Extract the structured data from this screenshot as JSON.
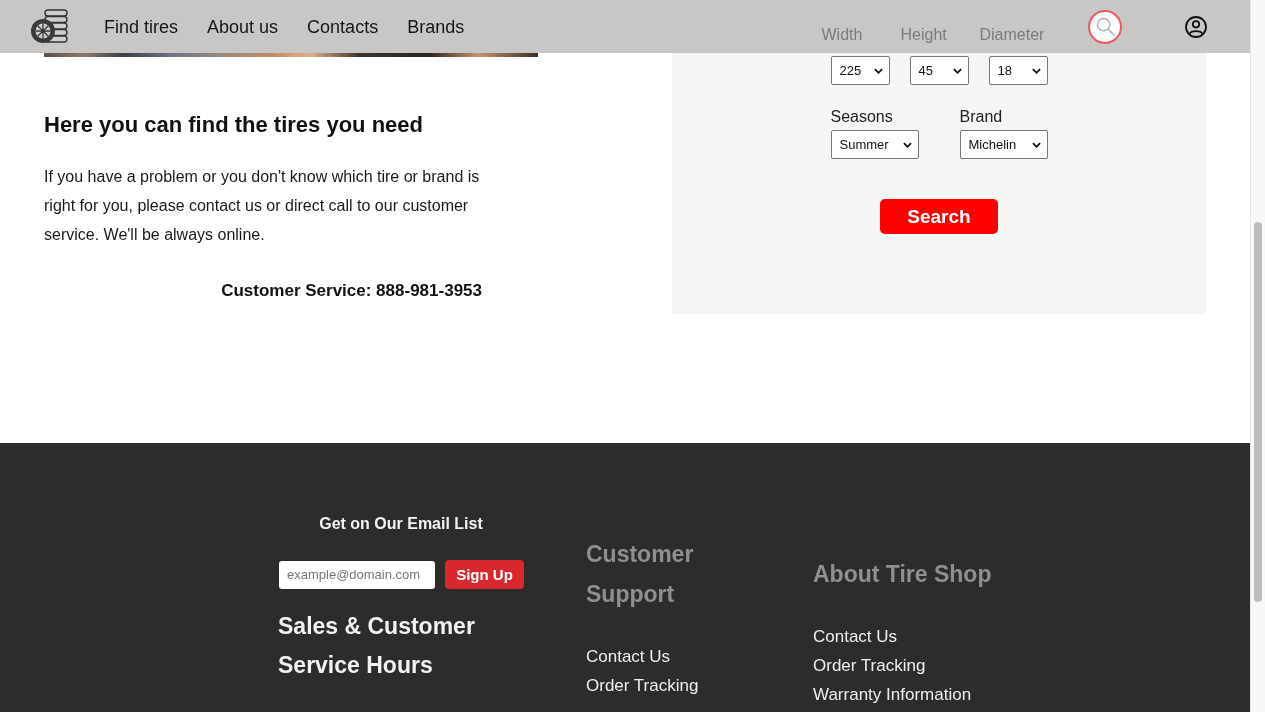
{
  "header": {
    "nav": [
      "Find tires",
      "About us",
      "Contacts",
      "Brands"
    ]
  },
  "intro": {
    "title": "Here you can find the tires you need",
    "text": "If you have a problem or you don't know which tire or brand is right for you, please contact us or direct call to our customer service. We'll be always online.",
    "customer_service": "Customer Service: 888-981-3953"
  },
  "filter": {
    "size_fields": [
      {
        "label": "Width",
        "value": "225"
      },
      {
        "label": "Height",
        "value": "45"
      },
      {
        "label": "Diameter",
        "value": "18"
      }
    ],
    "option_fields": [
      {
        "label": "Seasons",
        "value": "Summer"
      },
      {
        "label": "Brand",
        "value": "Michelin"
      }
    ],
    "search_button": "Search"
  },
  "footer": {
    "newsletter": {
      "title": "Get on Our Email List",
      "placeholder": "example@domain.com",
      "button": "Sign Up"
    },
    "hours_title": "Sales & Customer Service Hours",
    "columns": [
      {
        "title": "Customer Support",
        "links": [
          "Contact Us",
          "Order Tracking"
        ]
      },
      {
        "title": "About Tire Shop",
        "links": [
          "Contact Us",
          "Order Tracking",
          "Warranty Information"
        ]
      }
    ]
  }
}
